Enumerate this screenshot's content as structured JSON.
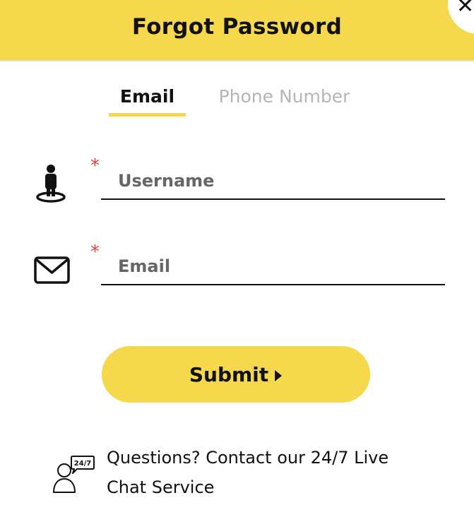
{
  "header": {
    "title": "Forgot Password",
    "close_glyph": "✕"
  },
  "tabs": [
    {
      "label": "Email",
      "active": true
    },
    {
      "label": "Phone Number",
      "active": false
    }
  ],
  "fields": {
    "username": {
      "placeholder": "Username",
      "value": "",
      "required": true,
      "required_mark": "*",
      "icon": "user-pin-icon"
    },
    "email": {
      "placeholder": "Email",
      "value": "",
      "required": true,
      "required_mark": "*",
      "icon": "envelope-icon"
    }
  },
  "submit": {
    "label": "Submit",
    "icon": "caret-right-icon"
  },
  "support": {
    "text": "Questions? Contact our 24/7 Live Chat Service",
    "icon_badge": "24/7",
    "icon": "live-chat-agent-icon"
  },
  "colors": {
    "accent": "#f6d84c",
    "required": "#e0443c",
    "inactive_tab": "#b5b5b5",
    "text": "#111111"
  }
}
